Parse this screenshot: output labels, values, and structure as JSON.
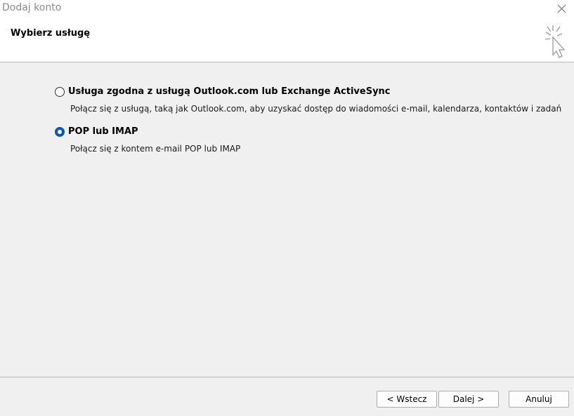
{
  "window": {
    "title": "Dodaj konto",
    "close_icon": "close-icon"
  },
  "header": {
    "title": "Wybierz usługę",
    "icon": "cursor-sparkle-icon"
  },
  "options": [
    {
      "label": "Usługa zgodna z usługą Outlook.com lub Exchange ActiveSync",
      "description": "Połącz się z usługą, taką jak Outlook.com, aby uzyskać dostęp do wiadomości e-mail, kalendarza, kontaktów i zadań",
      "selected": false
    },
    {
      "label": "POP lub IMAP",
      "description": "Połącz się z kontem e-mail POP lub IMAP",
      "selected": true
    }
  ],
  "buttons": {
    "back": "< Wstecz",
    "next": "Dalej >",
    "cancel": "Anuluj"
  },
  "colors": {
    "accent": "#0a5ab3",
    "background": "#f0f0f0"
  }
}
